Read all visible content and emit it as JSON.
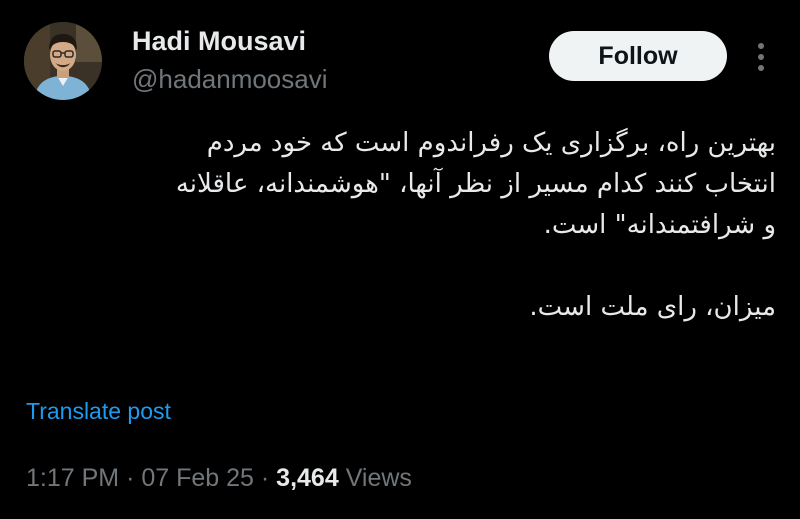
{
  "author": {
    "name": "Hadi Mousavi",
    "handle": "@hadanmoosavi",
    "avatar": "profile-photo"
  },
  "follow_button": {
    "label": "Follow"
  },
  "more_button": {
    "icon": "more-vertical-icon"
  },
  "tweet": {
    "paragraph_1_lines": [
      "بهترین راه، برگزاری یک رفراندوم است که خود مردم",
      "انتخاب کنند کدام مسیر از نظر آنها، \"هوشمندانه، عاقلانه",
      "و شرافتمندانه\" است."
    ],
    "paragraph_2": "میزان، رای ملت است."
  },
  "translate_link": "Translate post",
  "meta": {
    "time": "1:17 PM",
    "sep": "·",
    "date": "07 Feb 25",
    "views_count": "3,464",
    "views_label": "Views"
  },
  "colors": {
    "background": "#000000",
    "text": "#e7e9ea",
    "secondary": "#71767b",
    "link": "#1d9bf0",
    "follow_bg": "#eff3f4",
    "follow_text": "#0f1419"
  }
}
